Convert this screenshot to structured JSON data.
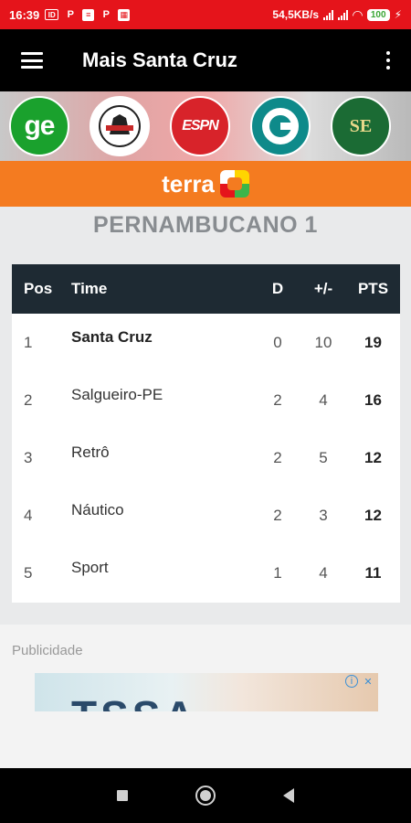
{
  "status_bar": {
    "time": "16:39",
    "left_icons": [
      "id-badge-icon",
      "P",
      "notes-icon",
      "P",
      "gallery-icon"
    ],
    "network_speed": "54,5KB/s",
    "battery": "100",
    "colors": {
      "background": "#e5141b"
    }
  },
  "app_bar": {
    "title": "Mais Santa Cruz"
  },
  "sources": [
    {
      "name": "ge",
      "label": "ge"
    },
    {
      "name": "club-crest",
      "label": ""
    },
    {
      "name": "espn",
      "label": "ESPN"
    },
    {
      "name": "o-logo",
      "label": ""
    },
    {
      "name": "se-logo",
      "label": "SE"
    }
  ],
  "terra": {
    "label": "terra",
    "color": "#f47b20"
  },
  "league": {
    "title": "PERNAMBUCANO 1"
  },
  "table": {
    "headers": {
      "pos": "Pos",
      "team": "Time",
      "d": "D",
      "gd": "+/-",
      "pts": "PTS"
    },
    "rows": [
      {
        "pos": "1",
        "team": "Santa Cruz",
        "d": "0",
        "gd": "10",
        "pts": "19"
      },
      {
        "pos": "2",
        "team": "Salgueiro-PE",
        "d": "2",
        "gd": "4",
        "pts": "16"
      },
      {
        "pos": "3",
        "team": "Retrô",
        "d": "2",
        "gd": "5",
        "pts": "12"
      },
      {
        "pos": "4",
        "team": "Náutico",
        "d": "2",
        "gd": "3",
        "pts": "12"
      },
      {
        "pos": "5",
        "team": "Sport",
        "d": "1",
        "gd": "4",
        "pts": "11"
      }
    ]
  },
  "ad": {
    "label": "Publicidade",
    "banner_text": "TSSA"
  }
}
